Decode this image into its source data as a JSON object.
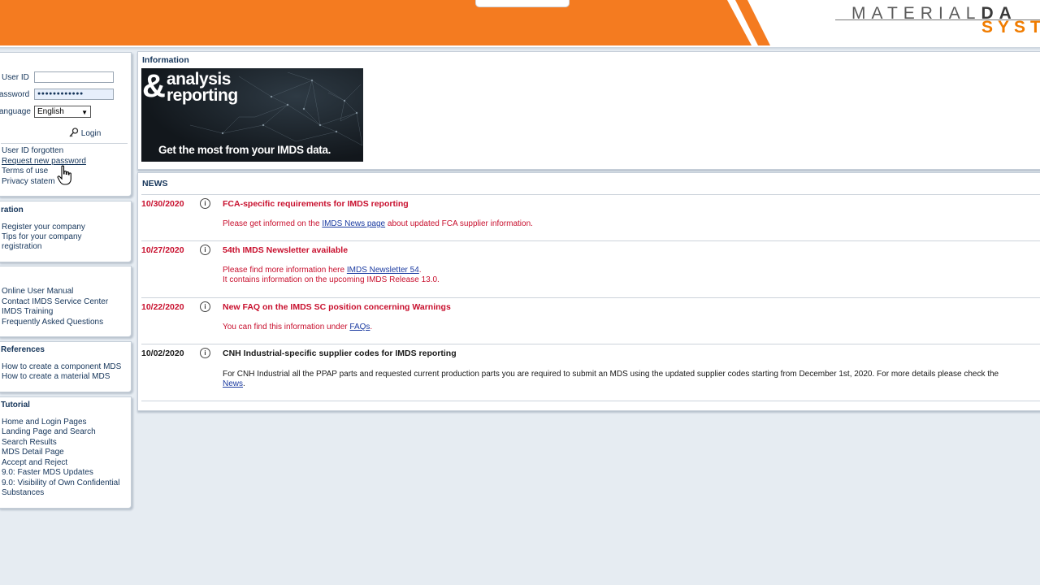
{
  "header": {
    "brand_line1_normal": "MATERIAL",
    "brand_line1_bold": "DA",
    "brand_line2": "SYST",
    "accent_color": "#f07c00"
  },
  "login": {
    "user_id_label": "User ID",
    "user_id_value": "",
    "password_label": "assword",
    "password_value": "●●●●●●●●●●●●",
    "language_label": "anguage",
    "language_value": "English",
    "login_label": "Login",
    "links": [
      "User ID forgotten",
      "Request new password",
      "Terms of use",
      "Privacy statem"
    ]
  },
  "registration": {
    "title": "ration",
    "links": [
      "Register your company",
      "Tips for your company",
      "registration"
    ]
  },
  "help": {
    "links": [
      "Online User Manual",
      "Contact IMDS Service Center",
      "IMDS Training",
      "Frequently Asked Questions"
    ]
  },
  "references": {
    "title": "References",
    "links": [
      "How to create a component MDS",
      "How to create a material MDS"
    ]
  },
  "tutorial": {
    "title": "Tutorial",
    "links": [
      "Home and Login Pages",
      "Landing Page and Search",
      "Search Results",
      "MDS Detail Page",
      "Accept and Reject",
      "9.0: Faster MDS Updates",
      "9.0: Visibility of Own Confidential",
      "Substances"
    ]
  },
  "information": {
    "title": "Information",
    "banner_amp": "&",
    "banner_line1": "analysis",
    "banner_line2": "reporting",
    "banner_tagline": "Get the most from your IMDS data."
  },
  "news": {
    "title": "NEWS",
    "items": [
      {
        "date": "10/30/2020",
        "headline": "FCA-specific requirements for IMDS reporting",
        "text_pre": "Please get informed on the ",
        "text_link": "IMDS News page",
        "text_post": " about updated FCA supplier information."
      },
      {
        "date": "10/27/2020",
        "headline": "54th IMDS Newsletter available",
        "text_pre": "Please find more information here ",
        "text_link": "IMDS Newsletter 54",
        "text_post": ".",
        "text_line2": "It contains information on the upcoming IMDS Release 13.0."
      },
      {
        "date": "10/22/2020",
        "headline": "New FAQ on the IMDS SC position concerning Warnings",
        "text_pre": "You can find this information under ",
        "text_link": "FAQs",
        "text_post": "."
      },
      {
        "date": "10/02/2020",
        "headline": "CNH Industrial-specific supplier codes for IMDS reporting",
        "text_pre": "For CNH Industrial all the PPAP parts and requested current production parts you are required to submit an MDS using the updated supplier codes starting from December 1st, 2020. For more details please check the",
        "text_link": "News",
        "text_post": "."
      }
    ]
  }
}
